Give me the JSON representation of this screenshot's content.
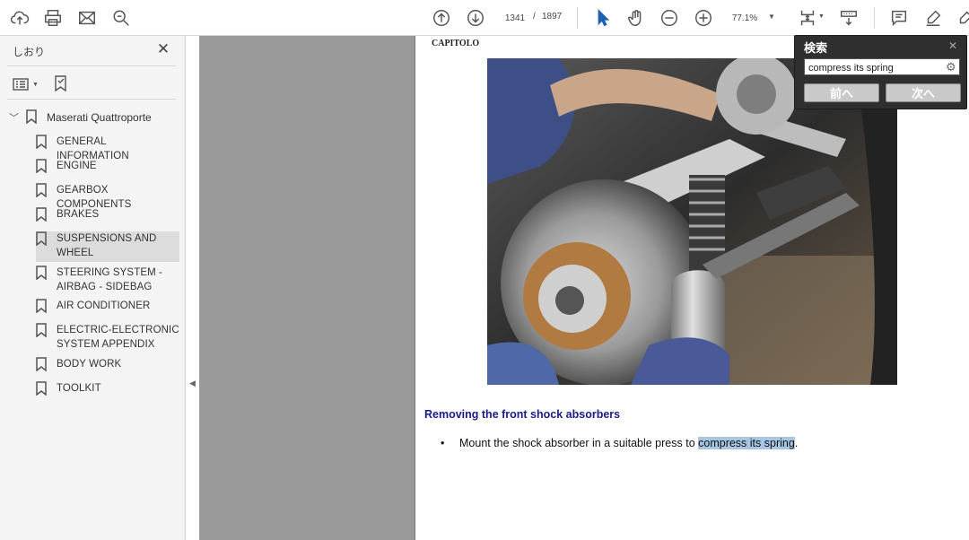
{
  "toolbar": {
    "page_current": "1341",
    "page_separator": "/",
    "page_total": "1897",
    "zoom": "77.1%"
  },
  "sidebar": {
    "title": "しおり",
    "root": "Maserati Quattroporte",
    "items": [
      {
        "label": "GENERAL INFORMATION"
      },
      {
        "label": "ENGINE"
      },
      {
        "label": "GEARBOX COMPONENTS"
      },
      {
        "label": "BRAKES"
      },
      {
        "label": "SUSPENSIONS AND WHEEL"
      },
      {
        "label": "STEERING SYSTEM - AIRBAG - SIDEBAG"
      },
      {
        "label": "AIR CONDITIONER"
      },
      {
        "label": "ELECTRIC-ELECTRONIC SYSTEM APPENDIX"
      },
      {
        "label": "BODY WORK"
      },
      {
        "label": "TOOLKIT"
      }
    ]
  },
  "document": {
    "chapter_label": "CAPITOLO",
    "heading": "Removing the front shock absorbers",
    "bullet_before": "Mount the shock absorber in a suitable press to ",
    "bullet_highlight": "compress its spring",
    "bullet_after": "."
  },
  "find": {
    "title": "検索",
    "query": "compress its spring",
    "prev_label": "前へ",
    "next_label": "次へ"
  }
}
